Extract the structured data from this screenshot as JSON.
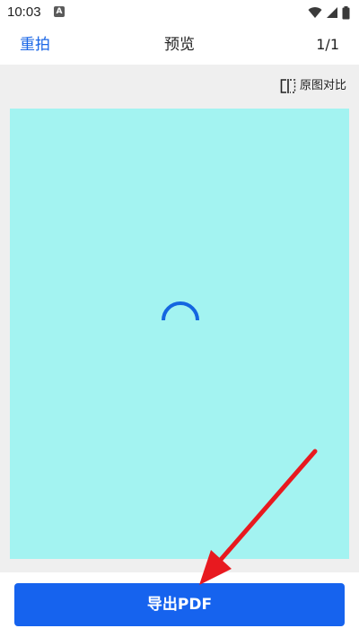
{
  "status_bar": {
    "time": "10:03",
    "app_badge": "A",
    "icons": [
      "wifi-icon",
      "signal-icon",
      "battery-icon"
    ]
  },
  "header": {
    "retake_label": "重拍",
    "title": "预览",
    "page_indicator": "1/1"
  },
  "preview": {
    "compare_label": "原图对比",
    "compare_icon": "split-compare-icon",
    "loading": true,
    "page_color": "#a3f3f1"
  },
  "footer": {
    "export_label": "导出PDF"
  },
  "colors": {
    "accent": "#1663ee",
    "link": "#1a66e6",
    "annotation_arrow": "#e8191f"
  }
}
